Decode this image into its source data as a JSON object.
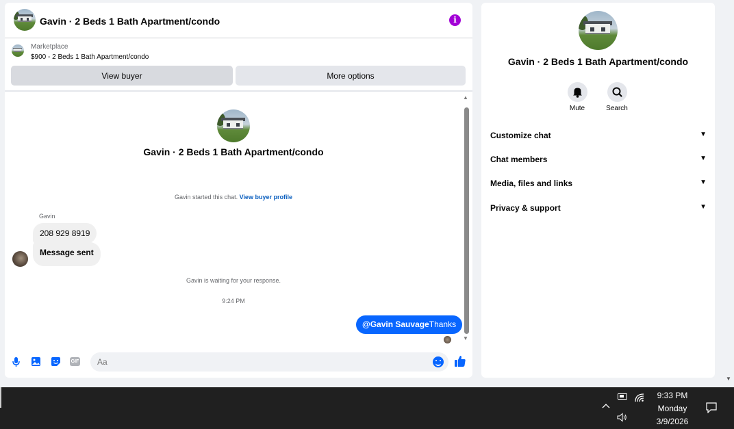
{
  "chat": {
    "header_title": "Gavin · 2 Beds 1 Bath Apartment/condo",
    "listing": {
      "source": "Marketplace",
      "title": "$900 - 2 Beds 1 Bath Apartment/condo"
    },
    "buttons": {
      "view_buyer": "View buyer",
      "more_options": "More options"
    },
    "center_title": "Gavin · 2 Beds 1 Bath Apartment/condo",
    "started_text": "Gavin started this chat.",
    "started_link": "View buyer profile",
    "sender_name": "Gavin",
    "messages_in": [
      "208 929 8919",
      "Message sent"
    ],
    "waiting_text": "Gavin is waiting for your response.",
    "time": "9:24 PM",
    "message_out": {
      "mention": "@Gavin Sauvage",
      "text": "Thanks"
    },
    "composer": {
      "placeholder": "Aa"
    }
  },
  "info": {
    "title": "Gavin · 2 Beds 1 Bath Apartment/condo",
    "actions": {
      "mute": "Mute",
      "search": "Search"
    },
    "sections": [
      "Customize chat",
      "Chat members",
      "Media, files and links",
      "Privacy & support"
    ]
  },
  "taskbar": {
    "time": "9:33 PM",
    "day": "Monday",
    "date": "3/9/2026"
  },
  "colors": {
    "accent": "#0866ff",
    "info_icon": "#a200d6"
  },
  "icons": [
    "info-icon",
    "mic-icon",
    "image-icon",
    "sticker-icon",
    "gif-icon",
    "emoji-icon",
    "like-icon",
    "bell-icon",
    "search-icon",
    "chevron-down-icon",
    "battery-icon",
    "wifi-icon",
    "volume-icon",
    "notification-icon"
  ]
}
